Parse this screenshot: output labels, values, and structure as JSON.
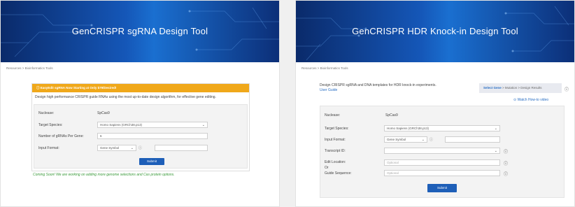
{
  "left": {
    "banner_title": "GenCRISPR sgRNA Design Tool",
    "breadcrumb": "Resources > Bioinformatics Tools",
    "promo": "EasyEdit sgRNA Now Starting at Only $79/Desired!",
    "intro": "Design high performance CRISPR guide RNAs using the most up-to-date design algorithm, for effective gene editing.",
    "form": {
      "nuclease_label": "Nuclease:",
      "nuclease_value": "SpCas9",
      "species_label": "Target Species:",
      "species_value": "Homo Sapiens (GRCh38.p13)",
      "num_label": "Number of gRNAs Per Gene:",
      "num_value": "6",
      "format_label": "Input Format:",
      "format_value": "Gene Symbol",
      "submit": "Submit"
    },
    "coming_soon": "Coming Soon! We are working on adding more genome selections and Cas protein options."
  },
  "right": {
    "banner_title": "GenCRISPR HDR Knock-in Design Tool",
    "breadcrumb": "Resources > Bioinformatics Tools",
    "intro": "Design CRISPR sgRNA and DNA templates for HDR knock-in experiments.",
    "user_guide": "User Guide",
    "steps": {
      "active": "Select Gene",
      "rest": "> Mutation > Design Results"
    },
    "video_link": "Watch How-to video",
    "form": {
      "nuclease_label": "Nuclease:",
      "nuclease_value": "SpCas9",
      "species_label": "Target Species:",
      "species_value": "Homo Sapiens (GRCh38.p13)",
      "format_label": "Input Format:",
      "format_value": "Gene Symbol",
      "transcript_label": "Transcript ID:",
      "edit_label": "Edit Location:",
      "edit_placeholder": "Optional",
      "or_label": "Or",
      "guide_label": "Guide Sequence:",
      "guide_placeholder": "Optional",
      "submit": "Submit"
    }
  },
  "colors": {
    "accent": "#1e5fb8",
    "promo": "#f0a81a",
    "green_note": "#3a9a3a"
  },
  "icons": [
    "info-icon",
    "play-icon",
    "chevron-down-icon"
  ]
}
